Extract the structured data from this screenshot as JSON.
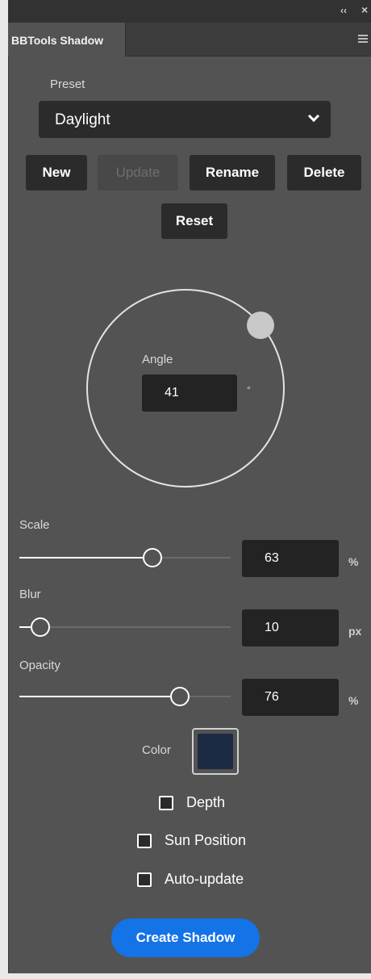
{
  "window": {
    "collapse_glyph": "‹‹",
    "close_glyph": "×"
  },
  "tab": {
    "title": "BBTools Shadow"
  },
  "preset": {
    "label": "Preset",
    "selected": "Daylight",
    "buttons": {
      "new": "New",
      "update": "Update",
      "rename": "Rename",
      "delete": "Delete",
      "reset": "Reset"
    }
  },
  "angle": {
    "label": "Angle",
    "value": "41",
    "unit": "°"
  },
  "scale": {
    "label": "Scale",
    "value": "63",
    "unit": "%",
    "slider_fraction": 0.63
  },
  "blur": {
    "label": "Blur",
    "value": "10",
    "unit": "px",
    "slider_fraction": 0.1
  },
  "opacity": {
    "label": "Opacity",
    "value": "76",
    "unit": "%",
    "slider_fraction": 0.76
  },
  "color": {
    "label": "Color",
    "swatch_hex": "#1c2a44"
  },
  "options": {
    "depth": {
      "label": "Depth",
      "checked": false
    },
    "sun_position": {
      "label": "Sun Position",
      "checked": false
    },
    "auto_update": {
      "label": "Auto-update",
      "checked": false
    }
  },
  "action": {
    "label": "Create Shadow",
    "accent": "#1473e6"
  }
}
